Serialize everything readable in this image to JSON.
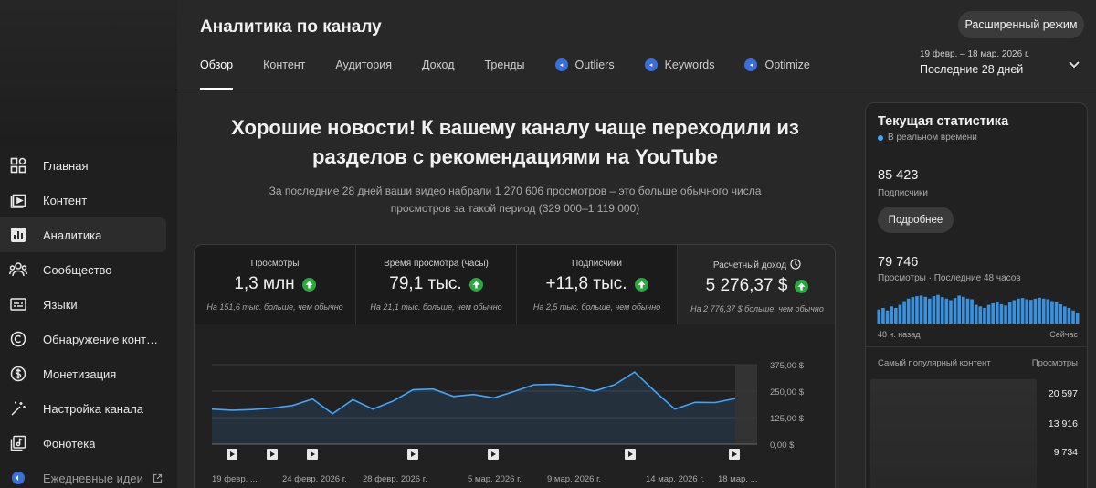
{
  "sidebar": {
    "items": [
      {
        "label": "Главная",
        "icon": "dashboard-icon"
      },
      {
        "label": "Контент",
        "icon": "content-icon"
      },
      {
        "label": "Аналитика",
        "icon": "analytics-icon",
        "active": true
      },
      {
        "label": "Сообщество",
        "icon": "community-icon"
      },
      {
        "label": "Языки",
        "icon": "subtitles-icon"
      },
      {
        "label": "Обнаружение контен...",
        "icon": "copyright-icon"
      },
      {
        "label": "Монетизация",
        "icon": "dollar-icon"
      },
      {
        "label": "Настройка канала",
        "icon": "magic-wand-icon"
      },
      {
        "label": "Фонотека",
        "icon": "music-library-icon"
      },
      {
        "label": "Ежедневные идеи",
        "icon": "ideas-icon"
      }
    ]
  },
  "header": {
    "title": "Аналитика по каналу",
    "advanced_mode": "Расширенный режим",
    "date_range": "19 февр. – 18 мар. 2026 г.",
    "period": "Последние 28 дней"
  },
  "tabs": [
    {
      "label": "Обзор",
      "active": true
    },
    {
      "label": "Контент"
    },
    {
      "label": "Аудитория"
    },
    {
      "label": "Доход"
    },
    {
      "label": "Тренды"
    },
    {
      "label": "Outliers",
      "ext": true
    },
    {
      "label": "Keywords",
      "ext": true
    },
    {
      "label": "Optimize",
      "ext": true
    }
  ],
  "main": {
    "headline_line1": "Хорошие новости! К вашему каналу чаще переходили из",
    "headline_line2": "разделов с рекомендациями на YouTube",
    "subline_line1": "За последние 28 дней ваши видео набрали 1 270 606 просмотров – это больше обычного числа",
    "subline_line2": "просмотров за такой период (329 000–1 119 000)"
  },
  "metrics": [
    {
      "label": "Просмотры",
      "value": "1,3 млн",
      "note": "На 151,6 тыс. больше, чем обычно"
    },
    {
      "label": "Время просмотра (часы)",
      "value": "79,1 тыс.",
      "note": "На 21,1 тыс. больше, чем обычно"
    },
    {
      "label": "Подписчики",
      "value": "+11,8 тыс.",
      "note": "На 2,5 тыс. больше, чем обычно"
    },
    {
      "label": "Расчетный доход",
      "value": "5 276,37 $",
      "note": "На 2 776,37 $ больше, чем обычно"
    }
  ],
  "chart_data": {
    "type": "area",
    "series": [
      {
        "values": [
          165,
          160,
          163,
          170,
          182,
          213,
          143,
          210,
          165,
          203,
          257,
          260,
          225,
          234,
          218,
          248,
          280,
          282,
          272,
          250,
          280,
          340,
          250,
          165,
          197,
          196,
          215
        ]
      }
    ],
    "ylim": [
      0,
      375
    ],
    "y_ticks": [
      "375,00 $",
      "250,00 $",
      "125,00 $",
      "0,00 $"
    ],
    "x_labels": [
      "19 февр. ...",
      "24 февр. 2026 г.",
      "28 февр. 2026 г.",
      "5 мар. 2026 г.",
      "9 мар. 2026 г.",
      "14 мар. 2026 г.",
      "18 мар. ..."
    ],
    "color": "#3ea6ff"
  },
  "realtime": {
    "title": "Текущая статистика",
    "live": "В реальном времени",
    "subscribers": "85 423",
    "subscribers_label": "Подписчики",
    "more_button": "Подробнее",
    "views": "79 746",
    "views_label": "Просмотры · Последние 48 часов",
    "bars": [
      0.45,
      0.5,
      0.42,
      0.55,
      0.5,
      0.6,
      0.72,
      0.8,
      0.85,
      0.88,
      0.9,
      0.86,
      0.8,
      0.88,
      0.92,
      0.85,
      0.8,
      0.75,
      0.82,
      0.9,
      0.86,
      0.8,
      0.78,
      0.6,
      0.55,
      0.5,
      0.6,
      0.65,
      0.7,
      0.62,
      0.58,
      0.7,
      0.75,
      0.8,
      0.82,
      0.78,
      0.76,
      0.8,
      0.83,
      0.8,
      0.78,
      0.72,
      0.68,
      0.62,
      0.55,
      0.5,
      0.42,
      0.35
    ],
    "axis_left": "48 ч. назад",
    "axis_right": "Сейчас",
    "top_content_label": "Самый популярный контент",
    "top_views_label": "Просмотры",
    "top_values": [
      "20 597",
      "13 916",
      "9 734"
    ]
  }
}
